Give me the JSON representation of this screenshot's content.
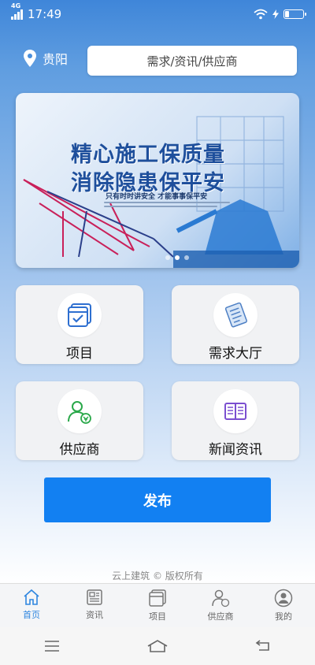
{
  "status_bar": {
    "network": "4G",
    "time": "17:49"
  },
  "location": {
    "city": "贵阳"
  },
  "search": {
    "placeholder": "需求/资讯/供应商"
  },
  "banner": {
    "line1": "精心施工保质量",
    "line2": "消除隐患保平安",
    "subtitle": "只有时时讲安全  才能事事保平安",
    "slide_count": 3,
    "active_slide": 2
  },
  "cards": [
    {
      "label": "项目",
      "icon": "project-icon"
    },
    {
      "label": "需求大厅",
      "icon": "demand-hall-icon"
    },
    {
      "label": "供应商",
      "icon": "supplier-icon"
    },
    {
      "label": "新闻资讯",
      "icon": "news-icon"
    }
  ],
  "publish_label": "发布",
  "copyright": "云上建筑 © 版权所有",
  "tabs": [
    {
      "label": "首页",
      "icon": "home-icon",
      "active": true
    },
    {
      "label": "资讯",
      "icon": "news-icon",
      "active": false
    },
    {
      "label": "项目",
      "icon": "project-icon",
      "active": false
    },
    {
      "label": "供应商",
      "icon": "supplier-icon",
      "active": false
    },
    {
      "label": "我的",
      "icon": "profile-icon",
      "active": false
    }
  ],
  "colors": {
    "primary": "#1280f2",
    "header_blue": "#3f86d9",
    "active_tab": "#2f86e0"
  }
}
